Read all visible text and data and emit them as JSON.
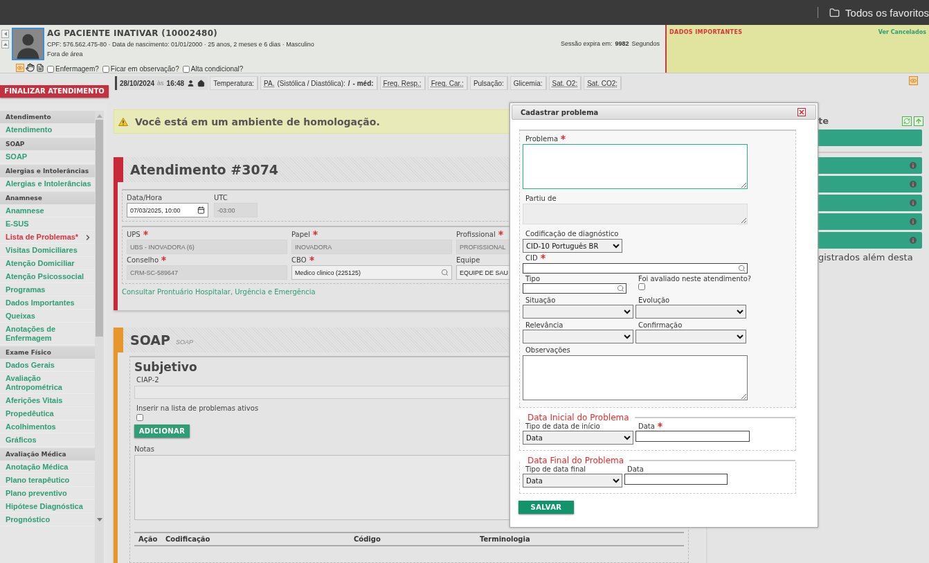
{
  "browser_bar": {
    "bookmarks": "Todos os favoritos"
  },
  "patient": {
    "name": "AG PACIENTE INATIVAR (10002480)",
    "details": "CPF: 576.562.475-80 · Data de nascimento: 01/01/2000 · 25 anos, 2 meses e 6 dias · Masculino",
    "location": "Fora de área",
    "flags": [
      {
        "label": "Enfermagem?",
        "checked": false
      },
      {
        "label": "Ficar em observação?",
        "checked": false
      },
      {
        "label": "Alta condicional?",
        "checked": false
      }
    ],
    "session": {
      "label": "Sessão expira em:",
      "value": "9982",
      "unit": "Segundos"
    }
  },
  "important_data": {
    "title": "DADOS IMPORTANTES",
    "link": "Ver Cancelados"
  },
  "finish_button": "FINALIZAR ATENDIMENTO",
  "vitals": {
    "date": "28/10/2024",
    "at": "às",
    "time": "16:48",
    "fields": [
      {
        "label": "Temperatura:",
        "abbr": false
      },
      {
        "label": "PA.",
        "abbr": true,
        "note": "(Sistólica / Diastólica):",
        "parts": [
          "/",
          "- méd:"
        ]
      },
      {
        "label": "Freq. Resp.:",
        "abbr": true
      },
      {
        "label": "Freq. Car.:",
        "abbr": true
      },
      {
        "label": "Pulsação:",
        "abbr": false
      },
      {
        "label": "Glicemia:",
        "abbr": false
      },
      {
        "label": "Sat. O2:",
        "abbr": true
      },
      {
        "label": "Sat. CO2:",
        "abbr": true
      }
    ]
  },
  "sidebar": {
    "sections": [
      {
        "title": "Atendimento",
        "items": [
          {
            "label": "Atendimento",
            "selected": false
          }
        ]
      },
      {
        "title": "SOAP",
        "items": [
          {
            "label": "SOAP",
            "selected": false
          }
        ]
      },
      {
        "title": "Alergias e Intolerâncias",
        "items": [
          {
            "label": "Alergias e Intolerâncias",
            "selected": false
          }
        ]
      },
      {
        "title": "Anamnese",
        "items": [
          {
            "label": "Anamnese",
            "selected": false
          },
          {
            "label": "E-SUS",
            "selected": false
          },
          {
            "label": "Lista de Problemas*",
            "selected": true
          },
          {
            "label": "Visitas Domiciliares",
            "selected": false
          },
          {
            "label": "Atenção Domiciliar",
            "selected": false
          },
          {
            "label": "Atenção Psicossocial",
            "selected": false
          },
          {
            "label": "Programas",
            "selected": false
          },
          {
            "label": "Dados Importantes",
            "selected": false
          },
          {
            "label": "Queixas",
            "selected": false
          },
          {
            "label": "Anotações de Enfermagem",
            "selected": false
          }
        ]
      },
      {
        "title": "Exame Físico",
        "items": [
          {
            "label": "Dados Gerais",
            "selected": false
          },
          {
            "label": "Avaliação Antropométrica",
            "selected": false
          },
          {
            "label": "Aferições Vitais",
            "selected": false
          },
          {
            "label": "Propedêutica",
            "selected": false
          },
          {
            "label": "Acolhimentos",
            "selected": false
          },
          {
            "label": "Gráficos",
            "selected": false
          }
        ]
      },
      {
        "title": "Avaliação Médica",
        "items": [
          {
            "label": "Anotação Médica",
            "selected": false
          },
          {
            "label": "Plano terapêutico",
            "selected": false
          },
          {
            "label": "Plano preventivo",
            "selected": false
          },
          {
            "label": "Hipótese Diagnóstica",
            "selected": false
          },
          {
            "label": "Prognóstico",
            "selected": false
          }
        ]
      }
    ]
  },
  "alert": "Você está em um ambiente de homologação.",
  "encounter": {
    "title": "Atendimento #3074",
    "datetime": {
      "label": "Data/Hora",
      "value": "07/03/2025, 10:00"
    },
    "utc": {
      "label": "UTC",
      "value": "-03:00"
    },
    "fields": [
      {
        "label": "UPS",
        "required": true,
        "value": "UBS - INOVADORA (6)",
        "disabled": true,
        "search": false
      },
      {
        "label": "Papel",
        "required": true,
        "value": "INOVADORA",
        "disabled": true,
        "search": false
      },
      {
        "label": "Profissional",
        "required": true,
        "value": "PROFISSIONAL",
        "disabled": true,
        "search": false
      },
      {
        "label": "Conselho",
        "required": true,
        "value": "CRM-SC-589647",
        "disabled": true,
        "search": false
      },
      {
        "label": "CBO",
        "required": true,
        "value": "Medico clinico (225125)",
        "disabled": false,
        "search": true
      },
      {
        "label": "Equipe",
        "required": false,
        "value": "EQUIPE DE SAU",
        "disabled": false
      }
    ],
    "link": "Consultar Prontuário Hospitalar, Urgência e Emergência"
  },
  "soap": {
    "title": "SOAP",
    "subtitle": "SOAP",
    "section": "Subjetivo",
    "ciap_label": "CIAP-2",
    "insert_label": "Inserir na lista de problemas ativos",
    "insert_checked": false,
    "add_button": "ADICIONAR",
    "notes_label": "Notas",
    "columns": [
      "Ação",
      "Codificação",
      "Código",
      "Terminologia"
    ]
  },
  "right_panel": {
    "title": "te",
    "note": "gistrados além desta"
  },
  "modal": {
    "title": "Cadastrar problema",
    "problem": {
      "label": "Problema",
      "required": true
    },
    "origin": {
      "label": "Partiu de"
    },
    "coding": {
      "label": "Codificação de diagnóstico",
      "value": "CID-10 Português BR"
    },
    "cid": {
      "label": "CID",
      "required": true
    },
    "type": {
      "label": "Tipo"
    },
    "evaluated": {
      "label": "Foi avaliado neste atendimento?",
      "checked": false
    },
    "selects": [
      {
        "label": "Situação"
      },
      {
        "label": "Evolução"
      },
      {
        "label": "Relevância"
      },
      {
        "label": "Confirmação"
      }
    ],
    "notes": {
      "label": "Observações"
    },
    "periods": [
      {
        "legend": "Data Inicial do Problema",
        "type_label": "Tipo de data de início",
        "type_value": "Data",
        "date_label": "Data",
        "required": true
      },
      {
        "legend": "Data Final do Problema",
        "type_label": "Tipo de data final",
        "type_value": "Data",
        "date_label": "Data",
        "required": false
      }
    ],
    "save": "SALVAR"
  }
}
